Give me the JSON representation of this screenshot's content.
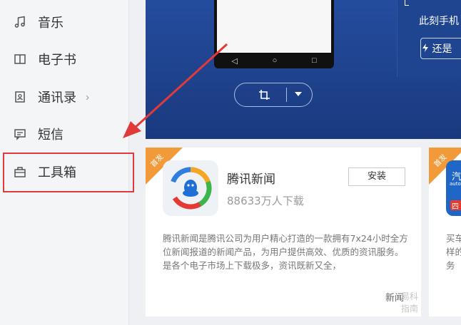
{
  "sidebar": {
    "items": [
      {
        "label": "音乐",
        "icon": "music-note-icon"
      },
      {
        "label": "电子书",
        "icon": "book-icon"
      },
      {
        "label": "通讯录",
        "icon": "contacts-icon",
        "arrow": "›"
      },
      {
        "label": "短信",
        "icon": "message-icon"
      },
      {
        "label": "工具箱",
        "icon": "toolbox-icon"
      }
    ]
  },
  "banner": {
    "right_panel_text": "此刻手机",
    "right_panel_button": "还是"
  },
  "cards": {
    "main": {
      "ribbon": "首发",
      "app_name": "腾讯新闻",
      "downloads": "88633万人下载",
      "install_label": "安装",
      "description": "腾讯新闻是腾讯公司为用户精心打造的一款拥有7x24小时全方位新闻报道的新闻产品，为用户提供高效、优质的资讯服务。是各个电子市场上下载极多，资讯既新又全，",
      "tag": "新闻",
      "watermark": "易科指南"
    },
    "side": {
      "ribbon": "首发",
      "icon_text": "汽",
      "icon_sub": "auto",
      "icon_badge": "四",
      "description": "买车样的务"
    }
  },
  "colors": {
    "banner_bg": "#1b3e86",
    "ribbon": "#f29a3a",
    "highlight": "#e23a3a"
  }
}
